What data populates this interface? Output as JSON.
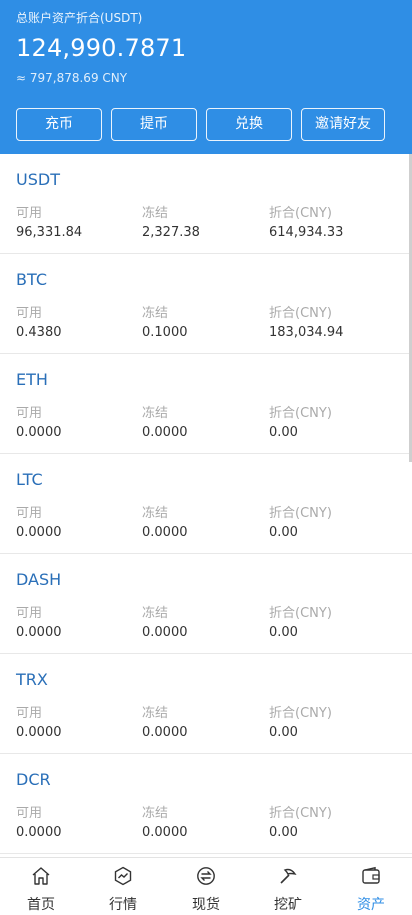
{
  "header": {
    "label": "总账户资产折合(USDT)",
    "total": "124,990.7871",
    "cny": "≈ 797,878.69 CNY",
    "buttons": [
      "充币",
      "提币",
      "兑换",
      "邀请好友"
    ]
  },
  "columns": [
    "可用",
    "冻结",
    "折合(CNY)"
  ],
  "assets": [
    {
      "name": "USDT",
      "available": "96,331.84",
      "frozen": "2,327.38",
      "cny": "614,934.33"
    },
    {
      "name": "BTC",
      "available": "0.4380",
      "frozen": "0.1000",
      "cny": "183,034.94"
    },
    {
      "name": "ETH",
      "available": "0.0000",
      "frozen": "0.0000",
      "cny": "0.00"
    },
    {
      "name": "LTC",
      "available": "0.0000",
      "frozen": "0.0000",
      "cny": "0.00"
    },
    {
      "name": "DASH",
      "available": "0.0000",
      "frozen": "0.0000",
      "cny": "0.00"
    },
    {
      "name": "TRX",
      "available": "0.0000",
      "frozen": "0.0000",
      "cny": "0.00"
    },
    {
      "name": "DCR",
      "available": "0.0000",
      "frozen": "0.0000",
      "cny": "0.00"
    }
  ],
  "tabbar": {
    "items": [
      {
        "label": "首页",
        "icon": "home-icon"
      },
      {
        "label": "行情",
        "icon": "market-icon"
      },
      {
        "label": "现货",
        "icon": "exchange-icon"
      },
      {
        "label": "挖矿",
        "icon": "mining-icon"
      },
      {
        "label": "资产",
        "icon": "wallet-icon"
      }
    ],
    "active_index": 4
  },
  "colors": {
    "accent": "#2f8ee5",
    "coin_name": "#2a6fb8"
  }
}
